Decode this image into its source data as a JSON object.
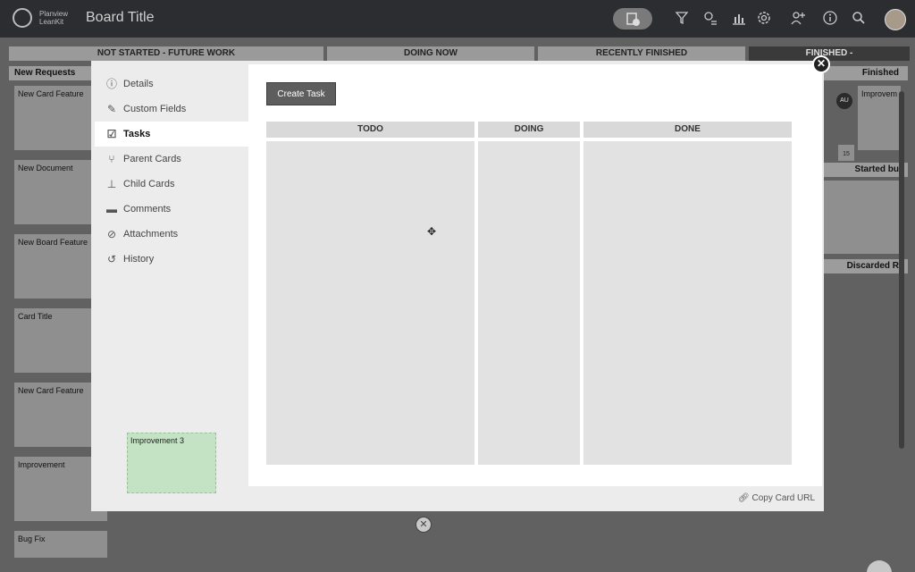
{
  "topbar": {
    "logo_line1": "Planview",
    "logo_line2": "LeanKit",
    "board_title": "Board Title",
    "icons": [
      "add-card-icon",
      "filter-icon",
      "activity-icon",
      "analytics-icon",
      "settings-icon",
      "add-user-icon",
      "info-icon",
      "search-icon"
    ]
  },
  "board": {
    "lanes": [
      {
        "label": "NOT STARTED - FUTURE WORK"
      },
      {
        "label": "DOING NOW"
      },
      {
        "label": "RECENTLY FINISHED"
      },
      {
        "label": "FINISHED -"
      }
    ],
    "sublane_new_requests": "New Requests",
    "sublane_finished": "Finished",
    "sublane_started": "Started bu",
    "sublane_discarded": "Discarded R",
    "cards": [
      "New Card Feature",
      "New Document",
      "New Board Feature",
      "Card Title",
      "New Card Feature",
      "Improvement",
      "Bug Fix"
    ],
    "right_card": "Improvem",
    "avatar_initials": "AU",
    "date_badge": "15"
  },
  "modal": {
    "sidebar": [
      {
        "label": "Details",
        "icon": "info-icon"
      },
      {
        "label": "Custom Fields",
        "icon": "edit-fields-icon"
      },
      {
        "label": "Tasks",
        "icon": "checkbox-icon",
        "active": true
      },
      {
        "label": "Parent Cards",
        "icon": "parent-cards-icon"
      },
      {
        "label": "Child Cards",
        "icon": "child-cards-icon"
      },
      {
        "label": "Comments",
        "icon": "comments-icon"
      },
      {
        "label": "Attachments",
        "icon": "paperclip-icon"
      },
      {
        "label": "History",
        "icon": "history-icon"
      }
    ],
    "create_task_label": "Create Task",
    "columns": [
      "TODO",
      "DOING",
      "DONE"
    ],
    "copy_url_label": "Copy Card URL",
    "dragged_card_label": "Improvement 3"
  }
}
